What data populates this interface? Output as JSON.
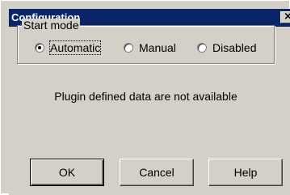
{
  "window": {
    "title": "Configuration",
    "close_glyph": "×"
  },
  "start_mode": {
    "legend": "Start mode",
    "selected": "Automatic",
    "options": [
      {
        "label": "Automatic",
        "selected": true
      },
      {
        "label": "Manual",
        "selected": false
      },
      {
        "label": "Disabled",
        "selected": false
      }
    ]
  },
  "message": "Plugin defined data are not available",
  "buttons": {
    "ok": "OK",
    "cancel": "Cancel",
    "help": "Help"
  },
  "colors": {
    "titlebar": "#0a246a",
    "face": "#d4d0c8"
  }
}
